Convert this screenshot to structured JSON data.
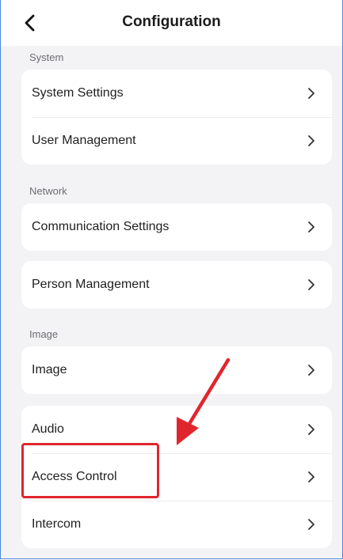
{
  "header": {
    "title": "Configuration",
    "back_icon": "chevron-left-icon"
  },
  "sections": [
    {
      "label": "System",
      "items": [
        "System Settings",
        "User Management"
      ]
    },
    {
      "label": "Network",
      "items": [
        "Communication Settings"
      ]
    },
    {
      "label": "",
      "items": [
        "Person Management"
      ]
    },
    {
      "label": "Image",
      "items": [
        "Image"
      ]
    },
    {
      "label": "",
      "items": [
        "Audio",
        "Access Control",
        "Intercom"
      ]
    }
  ],
  "annotation": {
    "highlighted_item": "Access Control",
    "color": "#e0262d"
  },
  "colors": {
    "background": "#f3f3f5",
    "card": "#ffffff",
    "frame_border": "#4a86d8"
  }
}
